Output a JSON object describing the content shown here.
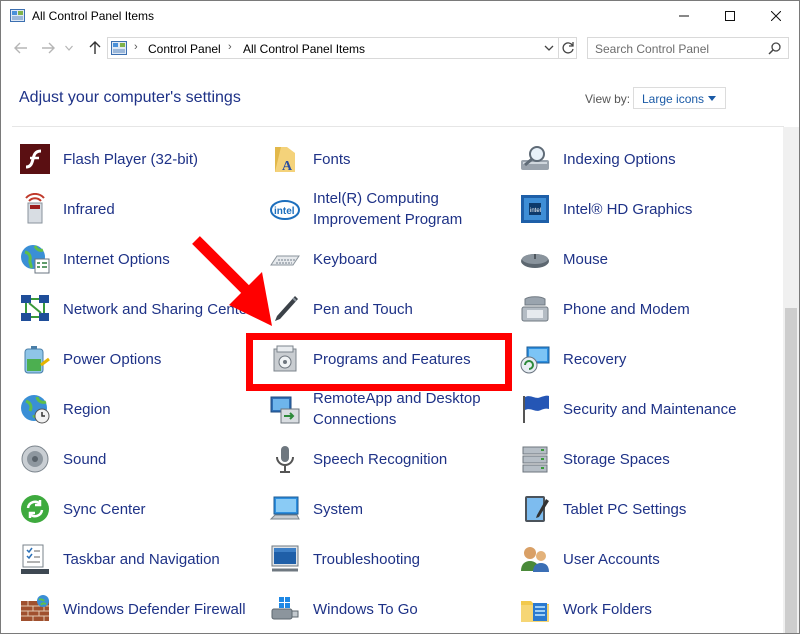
{
  "window": {
    "title": "All Control Panel Items",
    "controls": {
      "minimize": "minimize",
      "maximize": "maximize",
      "close": "close"
    }
  },
  "nav": {
    "breadcrumb": [
      "Control Panel",
      "All Control Panel Items"
    ],
    "search_placeholder": "Search Control Panel"
  },
  "header": {
    "heading": "Adjust your computer's settings",
    "view_by_label": "View by:",
    "view_by_value": "Large icons"
  },
  "items": [
    {
      "label": "Flash Player (32-bit)",
      "icon": "flash-player-icon"
    },
    {
      "label": "Fonts",
      "icon": "fonts-icon"
    },
    {
      "label": "Indexing Options",
      "icon": "indexing-options-icon"
    },
    {
      "label": "Infrared",
      "icon": "infrared-icon"
    },
    {
      "label": "Intel(R) Computing Improvement Program",
      "icon": "intel-icon"
    },
    {
      "label": "Intel® HD Graphics",
      "icon": "intel-graphics-icon"
    },
    {
      "label": "Internet Options",
      "icon": "internet-options-icon"
    },
    {
      "label": "Keyboard",
      "icon": "keyboard-icon"
    },
    {
      "label": "Mouse",
      "icon": "mouse-icon"
    },
    {
      "label": "Network and Sharing Center",
      "icon": "network-icon"
    },
    {
      "label": "Pen and Touch",
      "icon": "pen-icon"
    },
    {
      "label": "Phone and Modem",
      "icon": "phone-modem-icon"
    },
    {
      "label": "Power Options",
      "icon": "power-options-icon"
    },
    {
      "label": "Programs and Features",
      "icon": "programs-features-icon"
    },
    {
      "label": "Recovery",
      "icon": "recovery-icon"
    },
    {
      "label": "Region",
      "icon": "region-icon"
    },
    {
      "label": "RemoteApp and Desktop Connections",
      "icon": "remoteapp-icon"
    },
    {
      "label": "Security and Maintenance",
      "icon": "security-flag-icon"
    },
    {
      "label": "Sound",
      "icon": "speaker-icon"
    },
    {
      "label": "Speech Recognition",
      "icon": "microphone-icon"
    },
    {
      "label": "Storage Spaces",
      "icon": "storage-spaces-icon"
    },
    {
      "label": "Sync Center",
      "icon": "sync-center-icon"
    },
    {
      "label": "System",
      "icon": "system-icon"
    },
    {
      "label": "Tablet PC Settings",
      "icon": "tablet-icon"
    },
    {
      "label": "Taskbar and Navigation",
      "icon": "taskbar-icon"
    },
    {
      "label": "Troubleshooting",
      "icon": "troubleshooting-icon"
    },
    {
      "label": "User Accounts",
      "icon": "user-accounts-icon"
    },
    {
      "label": "Windows Defender Firewall",
      "icon": "firewall-icon"
    },
    {
      "label": "Windows To Go",
      "icon": "windows-to-go-icon"
    },
    {
      "label": "Work Folders",
      "icon": "work-folders-icon"
    }
  ],
  "colors": {
    "link": "#1e3287",
    "annotation": "#ff0000"
  }
}
